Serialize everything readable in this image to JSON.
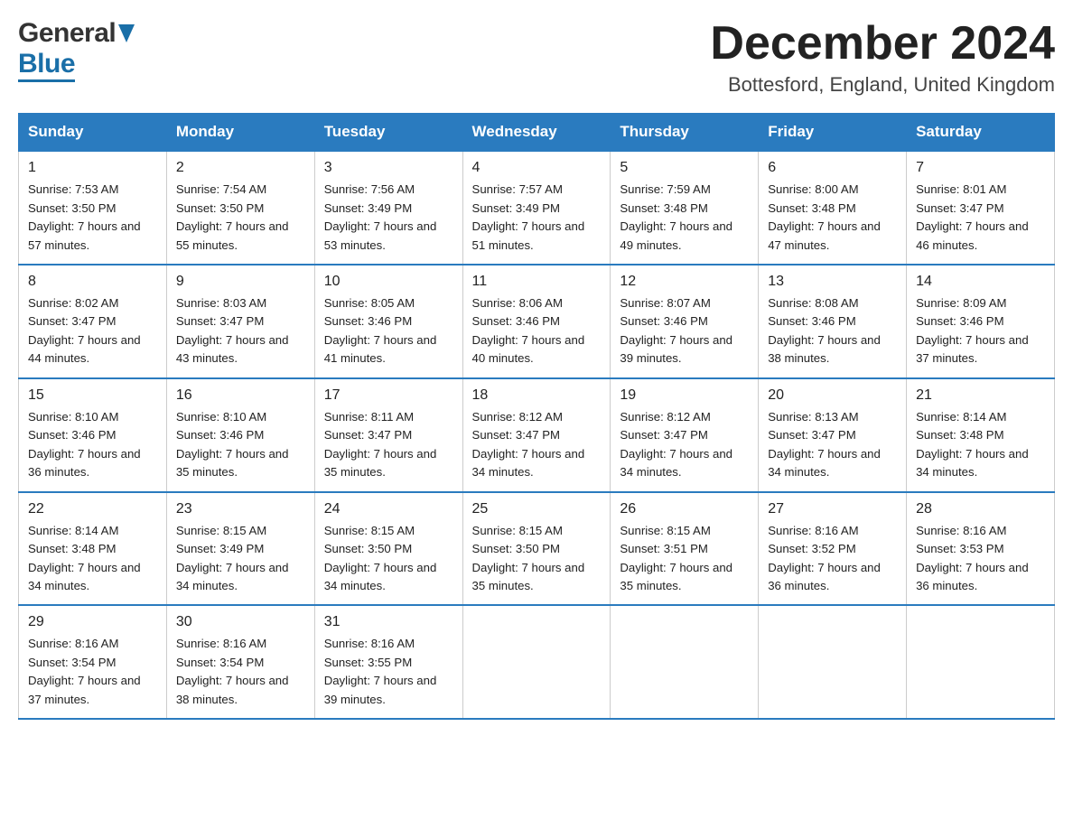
{
  "header": {
    "month_title": "December 2024",
    "location": "Bottesford, England, United Kingdom",
    "logo_general": "General",
    "logo_blue": "Blue"
  },
  "weekdays": [
    "Sunday",
    "Monday",
    "Tuesday",
    "Wednesday",
    "Thursday",
    "Friday",
    "Saturday"
  ],
  "weeks": [
    [
      {
        "day": "1",
        "sunrise": "7:53 AM",
        "sunset": "3:50 PM",
        "daylight": "7 hours and 57 minutes."
      },
      {
        "day": "2",
        "sunrise": "7:54 AM",
        "sunset": "3:50 PM",
        "daylight": "7 hours and 55 minutes."
      },
      {
        "day": "3",
        "sunrise": "7:56 AM",
        "sunset": "3:49 PM",
        "daylight": "7 hours and 53 minutes."
      },
      {
        "day": "4",
        "sunrise": "7:57 AM",
        "sunset": "3:49 PM",
        "daylight": "7 hours and 51 minutes."
      },
      {
        "day": "5",
        "sunrise": "7:59 AM",
        "sunset": "3:48 PM",
        "daylight": "7 hours and 49 minutes."
      },
      {
        "day": "6",
        "sunrise": "8:00 AM",
        "sunset": "3:48 PM",
        "daylight": "7 hours and 47 minutes."
      },
      {
        "day": "7",
        "sunrise": "8:01 AM",
        "sunset": "3:47 PM",
        "daylight": "7 hours and 46 minutes."
      }
    ],
    [
      {
        "day": "8",
        "sunrise": "8:02 AM",
        "sunset": "3:47 PM",
        "daylight": "7 hours and 44 minutes."
      },
      {
        "day": "9",
        "sunrise": "8:03 AM",
        "sunset": "3:47 PM",
        "daylight": "7 hours and 43 minutes."
      },
      {
        "day": "10",
        "sunrise": "8:05 AM",
        "sunset": "3:46 PM",
        "daylight": "7 hours and 41 minutes."
      },
      {
        "day": "11",
        "sunrise": "8:06 AM",
        "sunset": "3:46 PM",
        "daylight": "7 hours and 40 minutes."
      },
      {
        "day": "12",
        "sunrise": "8:07 AM",
        "sunset": "3:46 PM",
        "daylight": "7 hours and 39 minutes."
      },
      {
        "day": "13",
        "sunrise": "8:08 AM",
        "sunset": "3:46 PM",
        "daylight": "7 hours and 38 minutes."
      },
      {
        "day": "14",
        "sunrise": "8:09 AM",
        "sunset": "3:46 PM",
        "daylight": "7 hours and 37 minutes."
      }
    ],
    [
      {
        "day": "15",
        "sunrise": "8:10 AM",
        "sunset": "3:46 PM",
        "daylight": "7 hours and 36 minutes."
      },
      {
        "day": "16",
        "sunrise": "8:10 AM",
        "sunset": "3:46 PM",
        "daylight": "7 hours and 35 minutes."
      },
      {
        "day": "17",
        "sunrise": "8:11 AM",
        "sunset": "3:47 PM",
        "daylight": "7 hours and 35 minutes."
      },
      {
        "day": "18",
        "sunrise": "8:12 AM",
        "sunset": "3:47 PM",
        "daylight": "7 hours and 34 minutes."
      },
      {
        "day": "19",
        "sunrise": "8:12 AM",
        "sunset": "3:47 PM",
        "daylight": "7 hours and 34 minutes."
      },
      {
        "day": "20",
        "sunrise": "8:13 AM",
        "sunset": "3:47 PM",
        "daylight": "7 hours and 34 minutes."
      },
      {
        "day": "21",
        "sunrise": "8:14 AM",
        "sunset": "3:48 PM",
        "daylight": "7 hours and 34 minutes."
      }
    ],
    [
      {
        "day": "22",
        "sunrise": "8:14 AM",
        "sunset": "3:48 PM",
        "daylight": "7 hours and 34 minutes."
      },
      {
        "day": "23",
        "sunrise": "8:15 AM",
        "sunset": "3:49 PM",
        "daylight": "7 hours and 34 minutes."
      },
      {
        "day": "24",
        "sunrise": "8:15 AM",
        "sunset": "3:50 PM",
        "daylight": "7 hours and 34 minutes."
      },
      {
        "day": "25",
        "sunrise": "8:15 AM",
        "sunset": "3:50 PM",
        "daylight": "7 hours and 35 minutes."
      },
      {
        "day": "26",
        "sunrise": "8:15 AM",
        "sunset": "3:51 PM",
        "daylight": "7 hours and 35 minutes."
      },
      {
        "day": "27",
        "sunrise": "8:16 AM",
        "sunset": "3:52 PM",
        "daylight": "7 hours and 36 minutes."
      },
      {
        "day": "28",
        "sunrise": "8:16 AM",
        "sunset": "3:53 PM",
        "daylight": "7 hours and 36 minutes."
      }
    ],
    [
      {
        "day": "29",
        "sunrise": "8:16 AM",
        "sunset": "3:54 PM",
        "daylight": "7 hours and 37 minutes."
      },
      {
        "day": "30",
        "sunrise": "8:16 AM",
        "sunset": "3:54 PM",
        "daylight": "7 hours and 38 minutes."
      },
      {
        "day": "31",
        "sunrise": "8:16 AM",
        "sunset": "3:55 PM",
        "daylight": "7 hours and 39 minutes."
      },
      null,
      null,
      null,
      null
    ]
  ]
}
